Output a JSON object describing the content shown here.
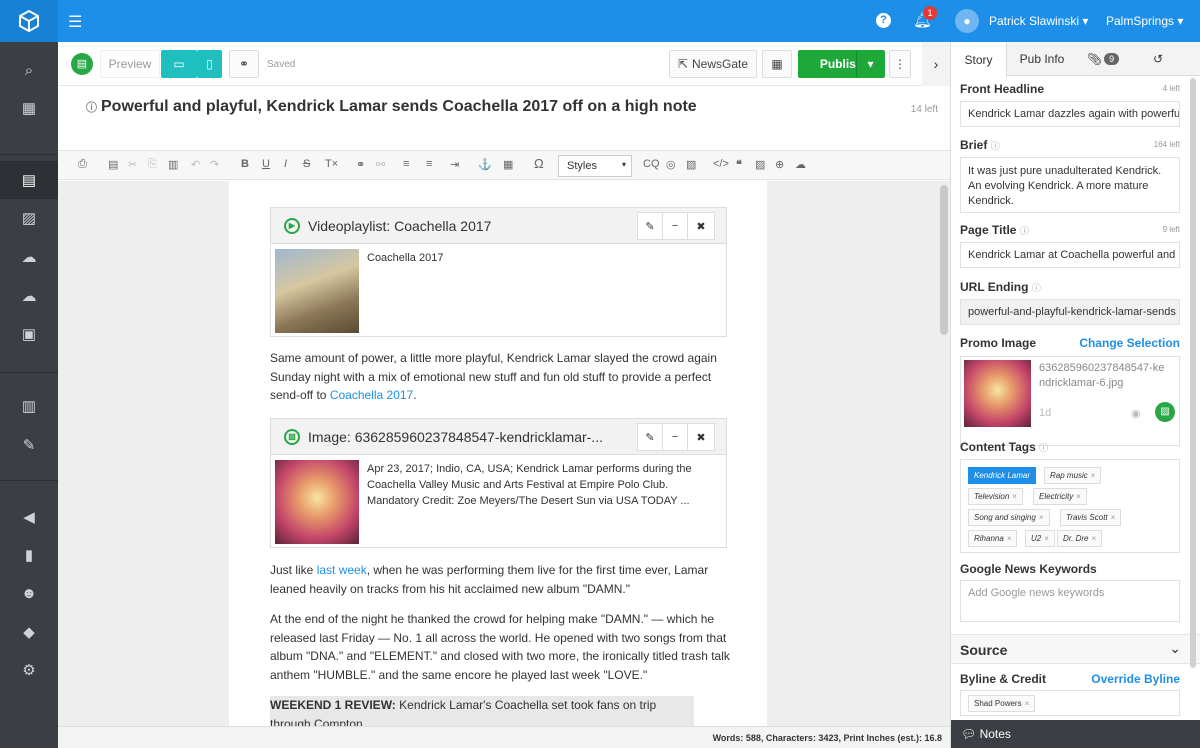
{
  "topbar": {
    "help": "?",
    "notification_count": "1",
    "user_name": "Patrick Slawinski ▾",
    "site_name": "PalmSprings ▾"
  },
  "sidebar": {
    "items": [
      "search-icon",
      "calendar-icon",
      "document-icon",
      "image-icon",
      "cloud-upload-icon",
      "cloud-download-icon",
      "video-icon",
      "newspaper-icon",
      "wrench-icon",
      "megaphone-icon",
      "bar-chart-icon",
      "users-icon",
      "tags-icon",
      "settings-icon"
    ]
  },
  "editor": {
    "preview_label": "Preview",
    "saved_label": "Saved",
    "newsgate_label": "NewsGate",
    "publish_label": "Publish",
    "headline": "Powerful and playful, Kendrick Lamar sends Coachella 2017 off on a high note",
    "headline_left": "14 left",
    "styles_label": "Styles",
    "video_embed": {
      "title": "Videoplaylist: Coachella 2017",
      "caption": "Coachella 2017"
    },
    "image_embed": {
      "title": "Image: 636285960237848547-kendricklamar-...",
      "caption": "Apr 23, 2017; Indio, CA, USA; Kendrick Lamar performs during the Coachella Valley Music and Arts Festival at Empire Polo Club. Mandatory Credit: Zoe Meyers/The Desert Sun via USA TODAY ..."
    },
    "para1_text": "Same amount of power, a little more playful, Kendrick Lamar slayed the crowd again Sunday night with a mix of emotional new stuff and fun old stuff to provide a perfect send-off to ",
    "para1_link": "Coachella 2017",
    "para1_end": ".",
    "para2_start": "Just like ",
    "para2_link": "last week",
    "para2_text": ", when he was performing them live for the first time ever, Lamar leaned heavily on tracks from his hit acclaimed new album \"DAMN.\"",
    "para3": "At the end of the night he thanked the crowd for helping make \"DAMN.\" — which he released last Friday — No. 1 all across the world. He opened with two songs from that album \"DNA.\" and \"ELEMENT.\" and closed with two more, the ironically titled trash talk anthem \"HUMBLE.\" and the same encore he played last week \"LOVE.\"",
    "para4_bold": "WEEKEND 1 REVIEW:",
    "para4_text": "Kendrick Lamar's Coachella set took fans on trip through Compton",
    "status": "Words: 588, Characters: 3423, Print Inches (est.): 16.8"
  },
  "rpanel": {
    "tab_story": "Story",
    "tab_pubinfo": "Pub Info",
    "tab_attach_count": "9",
    "front_headline_label": "Front Headline",
    "front_headline_count": "4 left",
    "front_headline_value": "Kendrick Lamar dazzles again with powerful",
    "brief_label": "Brief",
    "brief_count": "164 left",
    "brief_value": "It was just pure unadulterated Kendrick. An evolving Kendrick. A more mature Kendrick.",
    "page_title_label": "Page Title",
    "page_title_count": "9 left",
    "page_title_value": "Kendrick Lamar at Coachella powerful and",
    "url_label": "URL Ending",
    "url_value": "powerful-and-playful-kendrick-lamar-sends",
    "promo_label": "Promo Image",
    "change_selection": "Change Selection",
    "promo_filename": "636285960237848547-kendricklamar-6.jpg",
    "promo_age": "1d",
    "tags_label": "Content Tags",
    "tags": [
      "Kendrick Lamar",
      "Rap music",
      "Television",
      "Electricity",
      "Song and singing",
      "Travis Scott",
      "Rihanna",
      "U2",
      "Dr. Dre"
    ],
    "gnk_label": "Google News Keywords",
    "gnk_placeholder": "Add Google news keywords",
    "source_label": "Source",
    "byline_label": "Byline & Credit",
    "override_byline": "Override Byline",
    "byline_tag": "Shad Powers",
    "notes_label": "Notes"
  }
}
